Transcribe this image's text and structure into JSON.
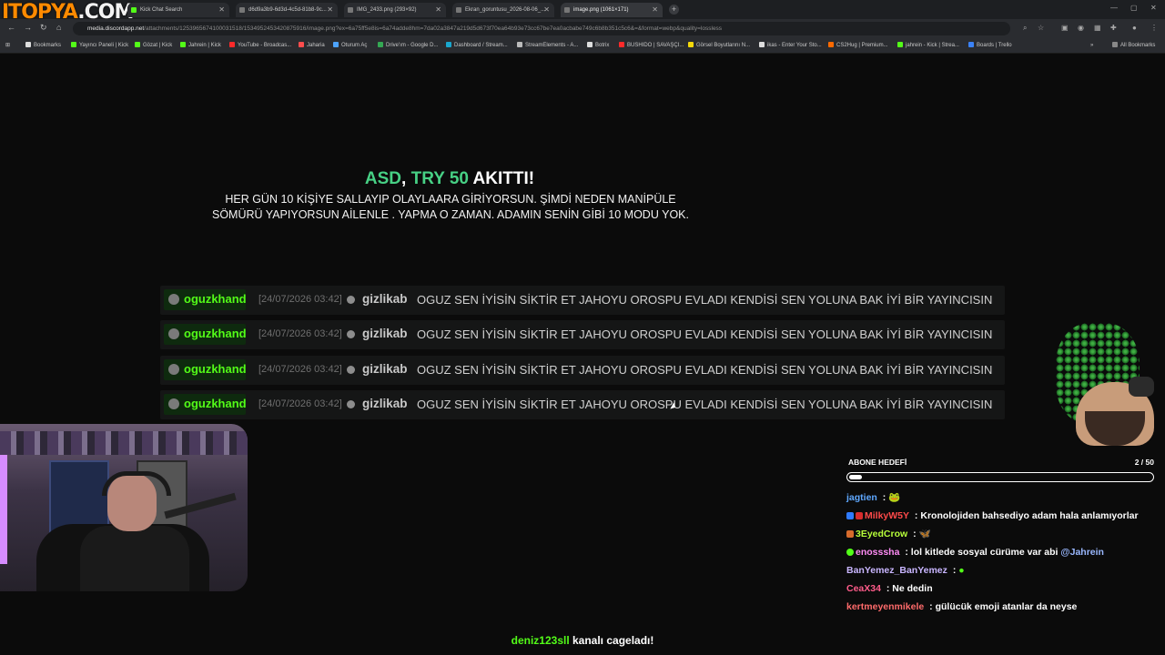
{
  "browser": {
    "logo_main": "ITOPYA",
    "logo_suffix": ".COM",
    "tabs": [
      {
        "title": "Kick Chat Search"
      },
      {
        "title": "d6d9a3b9-6d3d-4c5d-81b8-9c..."
      },
      {
        "title": "IMG_2433.png (293×92)"
      },
      {
        "title": "Ekran_goruntusu_2026-08-06_..."
      },
      {
        "title": "image.png (1061×171)"
      }
    ],
    "url_host": "media.discordapp.net",
    "url_path": "/attachments/1253965674100031518/1534952453420875916/image.png?ex=6a75ff5e8is=6a74adde8hm=7da02a3847a219d5d673f70ea64b93e73cc67be7ea0acbabe749c6b8b351c5c6&=&format=webp&quality=lossless",
    "bookmarks": [
      "Bookmarks",
      "Yayıncı Paneli | Kick",
      "Gözat | Kick",
      "Jahrein | Kick",
      "YouTube - Broadcas...",
      "Jaharia",
      "Oturum Aç",
      "Drive'ım - Google D...",
      "Dashboard / Stream...",
      "StreamElements - A...",
      "Botrix",
      "BUSHIDO | SAVAŞÇI...",
      "Görsel Boyutlarını N...",
      "ikas - Enter Your Sto...",
      "CS2Hug | Premium...",
      "jahrein - Kick | Strea...",
      "Boards | Trello"
    ],
    "all_bookmarks": "All Bookmarks"
  },
  "alert": {
    "donor": "ASD",
    "comma": ",",
    "amount": "TRY 50",
    "action": "AKITTI!",
    "message": "HER GÜN 10 KİŞİYE SALLAYIP OLAYLAARA GİRİYORSUN. ŞİMDİ NEDEN MANİPÜLE SÖMÜRÜ YAPIYORSUN AİLENLE . YAPMA O ZAMAN. ADAMIN SENİN GİBİ 10 MODU YOK."
  },
  "messages": [
    {
      "channel": "oguzkhand",
      "time": "[24/07/2026 03:42]",
      "user": "gizlikab",
      "text": "OGUZ SEN İYİSİN SİKTİR ET JAHOYU OROSPU EVLADI KENDİSİ SEN YOLUNA BAK İYİ BİR YAYINCISIN"
    },
    {
      "channel": "oguzkhand",
      "time": "[24/07/2026 03:42]",
      "user": "gizlikab",
      "text": "OGUZ SEN İYİSİN SİKTİR ET JAHOYU OROSPU EVLADI KENDİSİ SEN YOLUNA BAK İYİ BİR YAYINCISIN"
    },
    {
      "channel": "oguzkhand",
      "time": "[24/07/2026 03:42]",
      "user": "gizlikab",
      "text": "OGUZ SEN İYİSİN SİKTİR ET JAHOYU OROSPU EVLADI KENDİSİ SEN YOLUNA BAK İYİ BİR YAYINCISIN"
    },
    {
      "channel": "oguzkhand",
      "time": "[24/07/2026 03:42]",
      "user": "gizlikab",
      "text": "OGUZ SEN İYİSİN SİKTİR ET JAHOYU OROSPU EVLADI KENDİSİ SEN YOLUNA BAK İYİ BİR YAYINCISIN"
    }
  ],
  "subgoal": {
    "label": "ABONE HEDEFİ",
    "count": "2 / 50",
    "progress": 0.04
  },
  "chat": [
    {
      "user": "jagtien",
      "color": "#5fa8ff",
      "sep": " :",
      "text": ""
    },
    {
      "user": "MilkyW5Y",
      "color": "#ff4a4a",
      "sep": " :",
      "text": "Kronolojiden bahsediyo adam hala anlamıyorlar"
    },
    {
      "user": "3EyedCrow",
      "color": "#b7ff3a",
      "sep": " :",
      "text": ""
    },
    {
      "user": "enosssha",
      "color": "#ff8cf5",
      "sep": " :",
      "text": "lol kitlede sosyal cürüme var abi ",
      "mention": "@Jahrein"
    },
    {
      "user": "BanYemez_BanYemez",
      "color": "#c9b6ff",
      "sep": " :",
      "text": ""
    },
    {
      "user": "CeaX34",
      "color": "#ff5c8a",
      "sep": " :",
      "text": "Ne dedin"
    },
    {
      "user": "kertmeyenmikele",
      "color": "#ff6b6b",
      "sep": " :",
      "text": "gülücük emoji atanlar da neyse"
    }
  ],
  "bottom": {
    "user": "deniz123sll",
    "text": " kanalı cageladı!"
  },
  "colors": {
    "accent_green": "#53fc18",
    "alert_green": "#47d185"
  }
}
